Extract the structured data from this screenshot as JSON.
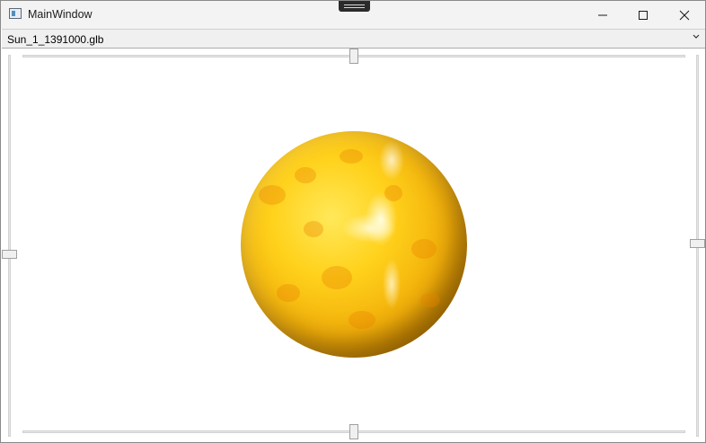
{
  "window": {
    "title": "MainWindow"
  },
  "model_selector": {
    "selected": "Sun_1_1391000.glb"
  },
  "sliders": {
    "top_horizontal": 0.5,
    "bottom_horizontal": 0.5,
    "left_vertical": 0.55,
    "right_vertical": 0.5
  },
  "viewport": {
    "object": "sun"
  }
}
